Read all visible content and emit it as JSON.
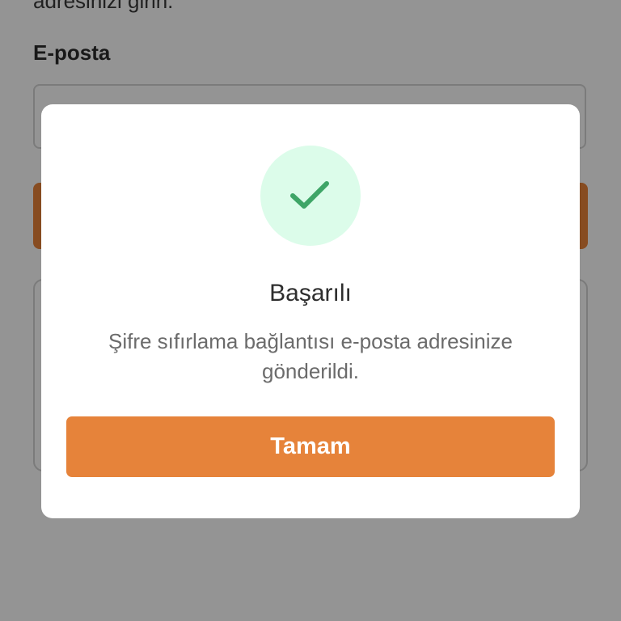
{
  "background": {
    "top_text": "adresinizi girin.",
    "email_label": "E-posta"
  },
  "dialog": {
    "icon": "checkmark-icon",
    "title": "Başarılı",
    "message": "Şifre sıfırlama bağlantısı e-posta adresinize gönderildi.",
    "ok_label": "Tamam"
  },
  "colors": {
    "accent": "#e6833a",
    "success_bg": "#dcfcea",
    "success_icon": "#3ea567",
    "overlay": "rgba(0,0,0,0.42)"
  }
}
